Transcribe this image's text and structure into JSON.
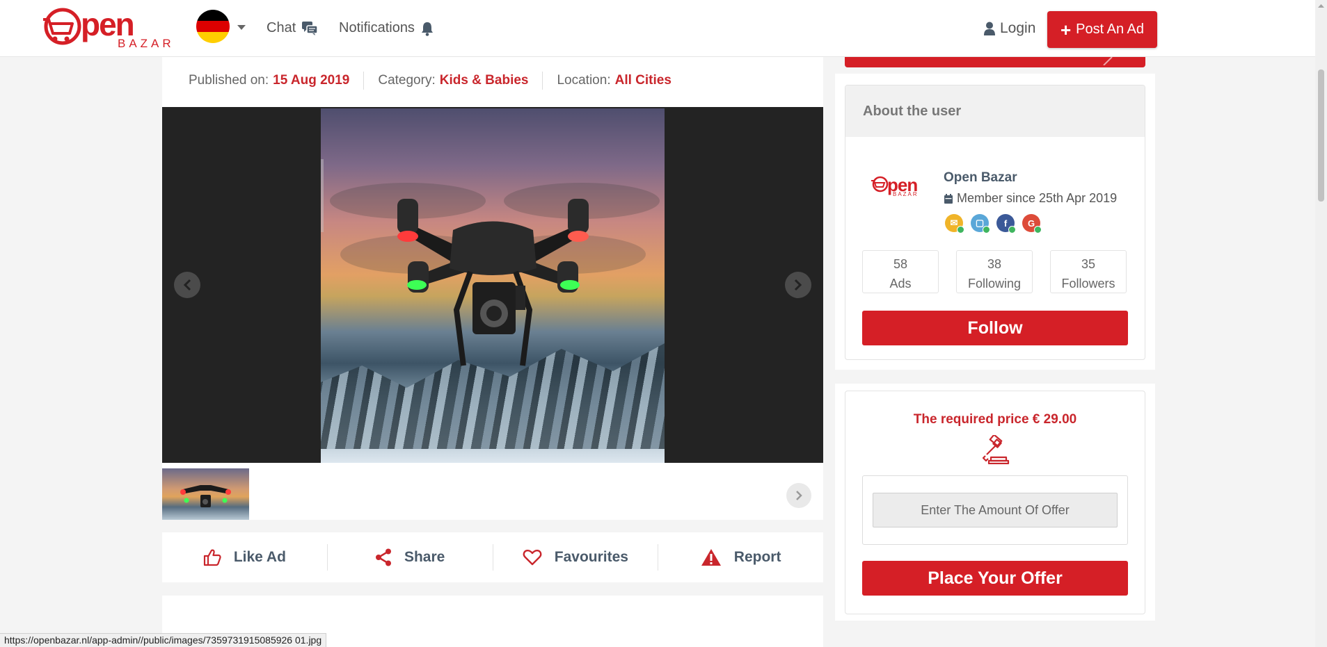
{
  "header": {
    "logo_main": "pen",
    "logo_sub": "BAZAR",
    "nav_chat": "Chat",
    "nav_notifications": "Notifications",
    "login": "Login",
    "post_ad": "Post An Ad"
  },
  "listing": {
    "published_label": "Published on:",
    "published_value": "15 Aug 2019",
    "category_label": "Category:",
    "category_value": "Kids & Babies",
    "location_label": "Location:",
    "location_value": "All Cities"
  },
  "actions": [
    {
      "label": "Like Ad",
      "icon": "thumbs-up-icon"
    },
    {
      "label": "Share",
      "icon": "share-icon"
    },
    {
      "label": "Favourites",
      "icon": "heart-icon"
    },
    {
      "label": "Report",
      "icon": "warning-icon"
    }
  ],
  "user": {
    "section_title": "About the user",
    "logo_text": "pen",
    "logo_sub": "BAZAR",
    "name": "Open Bazar",
    "member_since": "Member since 25th Apr 2019",
    "verifications": [
      "email-verified-icon",
      "phone-verified-icon",
      "facebook-verified-icon",
      "google-verified-icon"
    ],
    "stats": [
      {
        "value": "58",
        "label": "Ads"
      },
      {
        "value": "38",
        "label": "Following"
      },
      {
        "value": "35",
        "label": "Followers"
      }
    ],
    "follow_button": "Follow"
  },
  "offer": {
    "price_text": "The required price € 29.00",
    "input_placeholder": "Enter The Amount Of Offer",
    "place_button": "Place Your Offer"
  },
  "status_url": "https://openbazar.nl/app-admin//public/images/7359731915085926 01.jpg",
  "colors": {
    "brand_red": "#d51f26",
    "text_dark": "#4a5a6a"
  }
}
